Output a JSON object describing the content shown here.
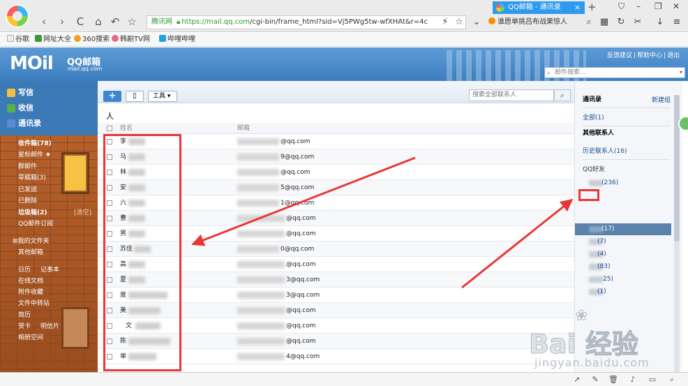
{
  "browser": {
    "tab_title": "QQ邮箱 - 通讯录",
    "address_cert": "腾讯网",
    "address_url_host": "https://mail.qq.com",
    "address_url_path": "/cgi-bin/frame_html?sid=Vj5PWg5tw-wfXHAt&r=4c",
    "news_text": "谁愿单挑吕布战果惊人",
    "new_tab": "+",
    "nav": {
      "back": "‹",
      "forward": "›",
      "reload": "C",
      "home": "⌂",
      "undo": "↶",
      "star": "☆"
    }
  },
  "bookmarks": [
    {
      "label": "谷歌",
      "color": "#4a90d9"
    },
    {
      "label": "网址大全",
      "color": "#3a9a3a"
    },
    {
      "label": "360搜索",
      "color": "#f0a020"
    },
    {
      "label": "韩剧TV网",
      "color": "#e46a8a"
    },
    {
      "label": "哔哩哔哩",
      "color": "#23a5d8"
    }
  ],
  "mail": {
    "logo_main": "MOil",
    "logo_qq": "QQ邮箱",
    "logo_domain": "mail.qq.com",
    "top_links": [
      "反馈建议",
      "帮助中心",
      "退出"
    ],
    "search_placeholder": "邮件搜索..."
  },
  "nav_primary": [
    {
      "label": "写信",
      "color": "#f0c040"
    },
    {
      "label": "收信",
      "color": "#5ab04a"
    },
    {
      "label": "通讯录",
      "color": "#5a8ad0"
    }
  ],
  "nav_folders": [
    {
      "label": "收件箱(78)",
      "bold": true
    },
    {
      "label": "星标邮件 ★",
      "bold": false
    },
    {
      "label": "群邮件",
      "bold": false
    },
    {
      "label": "草稿箱(3)",
      "bold": false
    },
    {
      "label": "已发送",
      "bold": false
    },
    {
      "label": "已删除",
      "bold": false
    },
    {
      "label": "垃圾箱(2)",
      "bold": true
    },
    {
      "label": "QQ邮件订阅",
      "bold": false
    },
    {
      "label": "我的文件夹",
      "bold": false
    },
    {
      "label": "其他邮箱",
      "bold": false
    },
    {
      "label": "日历",
      "bold": false
    },
    {
      "label": "在线文档",
      "bold": false
    },
    {
      "label": "附件收藏",
      "bold": false
    },
    {
      "label": "文件中转站",
      "bold": false
    },
    {
      "label": "简历",
      "bold": false
    },
    {
      "label": "贺卡",
      "bold": false
    },
    {
      "label": "相册空间",
      "bold": false
    }
  ],
  "nav_extra": {
    "clear": "[清空]",
    "notebook": "记事本",
    "postcard": "明信片"
  },
  "toolbar": {
    "add": "+",
    "device": "▯",
    "tools": "工具 ▾",
    "search_placeholder": "搜索全部联系人",
    "search_icon": "search-icon"
  },
  "group_title": "人",
  "table": {
    "headers": {
      "name": "姓名",
      "email": "邮箱"
    },
    "rows": [
      {
        "name": "李",
        "email": "@qq.com"
      },
      {
        "name": "马",
        "email": "9@qq.com"
      },
      {
        "name": "林",
        "email": "@qq.com"
      },
      {
        "name": "安",
        "email": "5@qq.com"
      },
      {
        "name": "六",
        "email": "1@qq.com"
      },
      {
        "name": "曹",
        "email": "@qq.com"
      },
      {
        "name": "男",
        "email": "@qq.com"
      },
      {
        "name": "苏佳",
        "email": "0@qq.com"
      },
      {
        "name": "高",
        "email": "@qq.com"
      },
      {
        "name": "夏",
        "email": "3@qq.com"
      },
      {
        "name": "度",
        "email": "3@qq.com"
      },
      {
        "name": "美",
        "email": "@qq.com"
      },
      {
        "name": "文",
        "email": "@qq.com"
      },
      {
        "name": "陈",
        "email": "@qq.com"
      },
      {
        "name": "单",
        "email": "4@qq.com"
      }
    ]
  },
  "contacts_panel": {
    "title": "通讯录",
    "new_group": "新建组",
    "all": "全部(1)",
    "other_title": "其他联系人",
    "history": "历史联系人(16)",
    "qq_friends": "QQ好友",
    "groups": [
      "(236)",
      "(17)",
      "(7)",
      "(4)",
      "(83)",
      "25)",
      "(1)"
    ]
  },
  "watermark": {
    "text": "Bai 经验",
    "sub": "jingyan.baidu.com",
    "paw": "paw-icon"
  },
  "colors": {
    "accent": "#3b79b7",
    "annotation": "#e93737",
    "selected": "#5a82aa"
  }
}
